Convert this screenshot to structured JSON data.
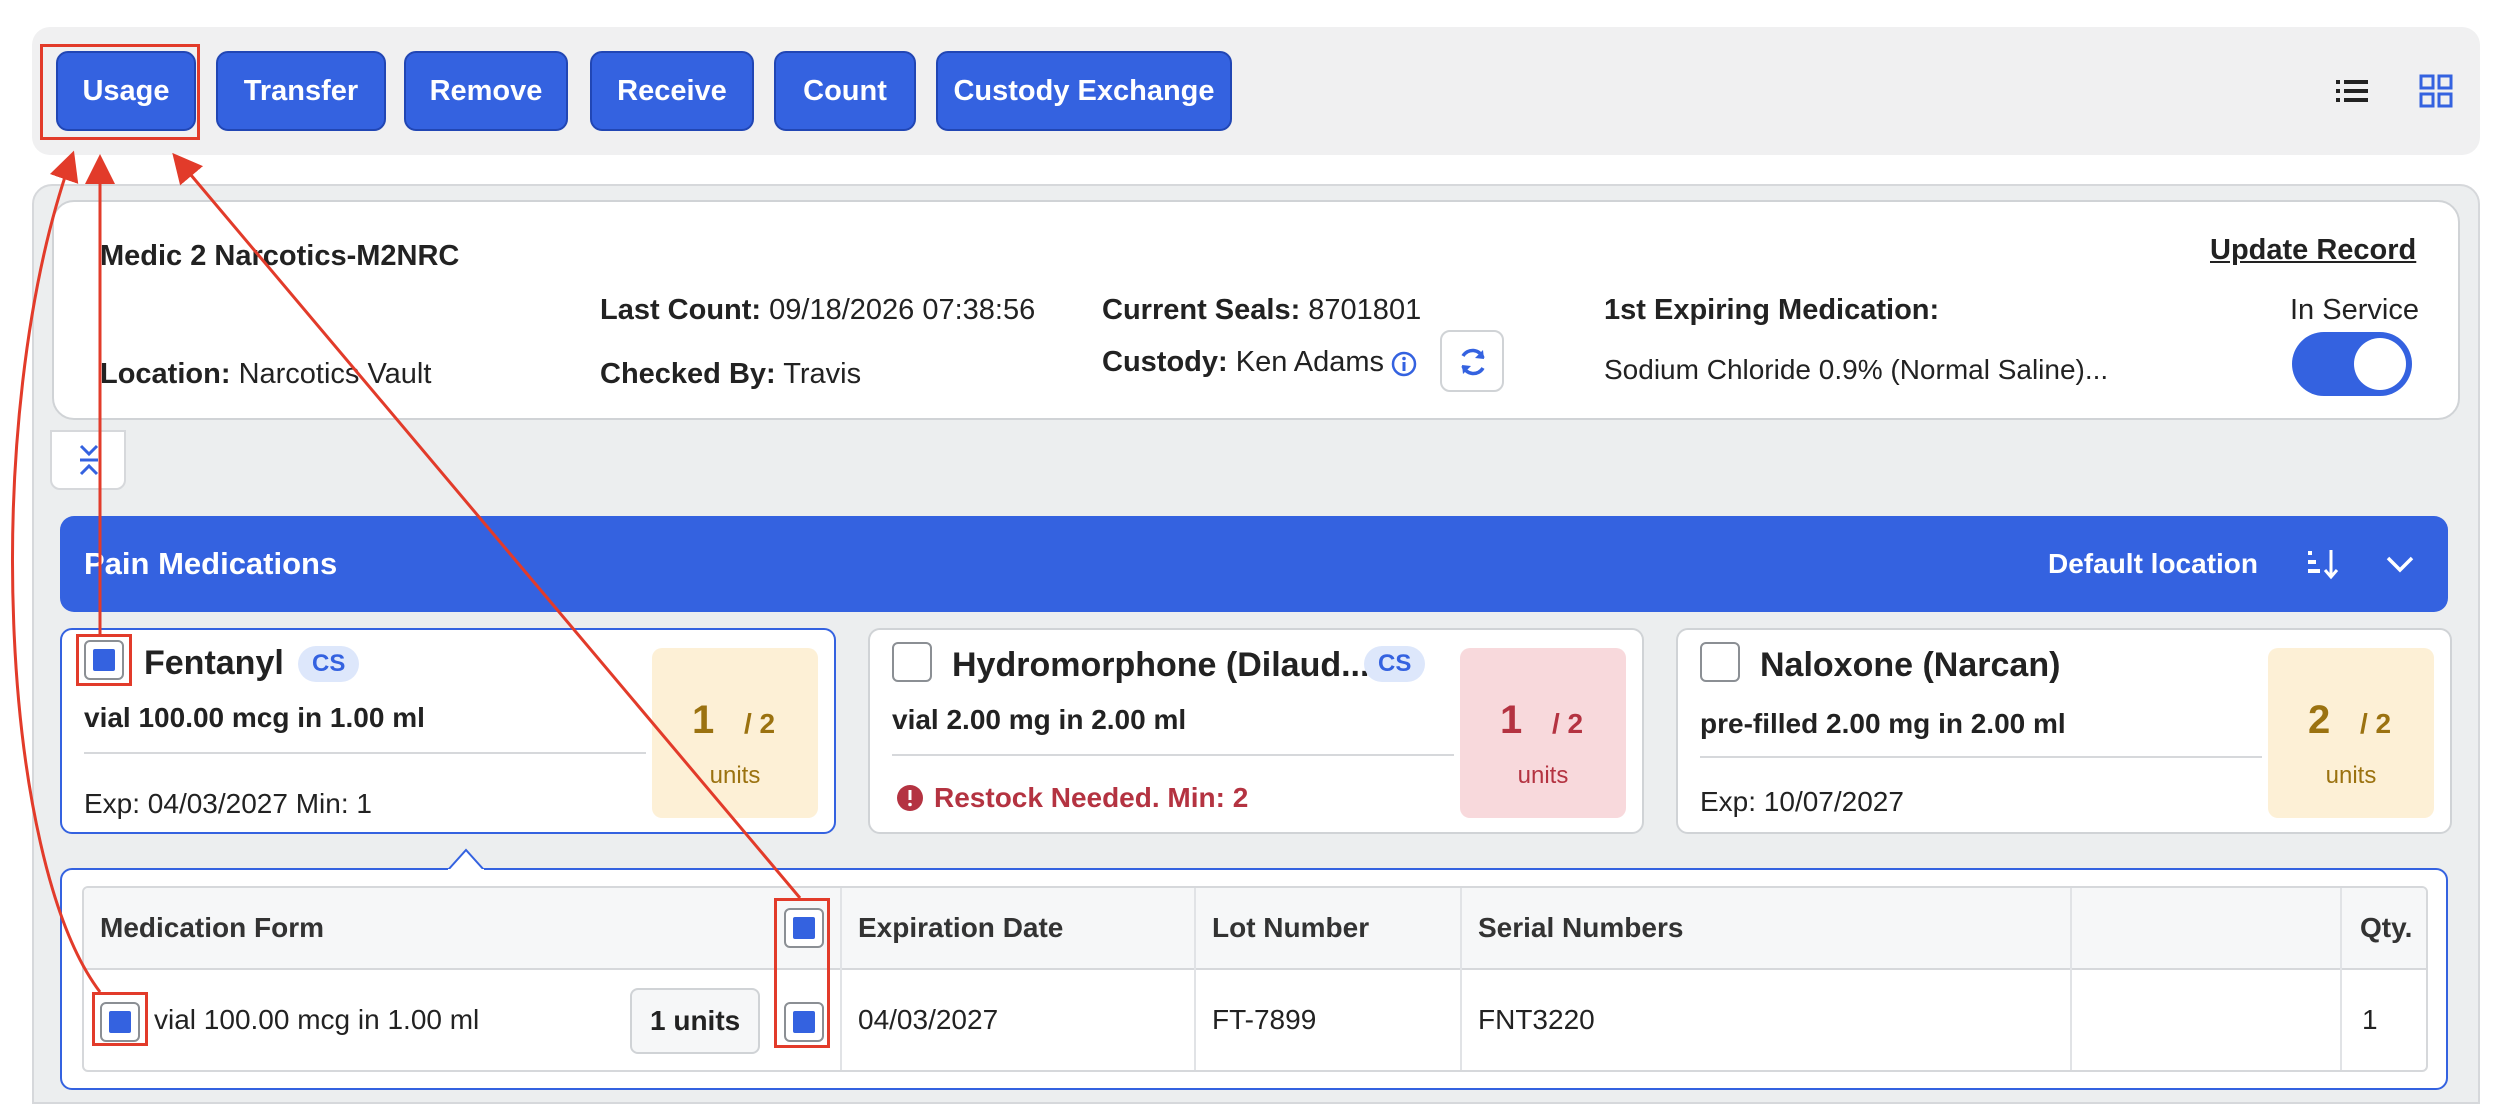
{
  "toolbar": {
    "buttons": [
      "Usage",
      "Transfer",
      "Remove",
      "Receive",
      "Count",
      "Custody Exchange"
    ],
    "list_view_icon": "list-icon",
    "grid_view_icon": "grid-icon"
  },
  "unit_info": {
    "name": "Medic 2 Narcotics-M2NRC",
    "location_label": "Location:",
    "location_value": "Narcotics Vault",
    "last_count_label": "Last Count:",
    "last_count_value": "09/18/2026 07:38:56",
    "checked_by_label": "Checked By:",
    "checked_by_value": "Travis",
    "seals_label": "Current Seals:",
    "seals_value": "8701801",
    "custody_label": "Custody:",
    "custody_value": "Ken Adams",
    "expiring_label": "1st Expiring Medication:",
    "expiring_value": "Sodium Chloride 0.9% (Normal Saline)...",
    "update_record": "Update Record",
    "service_label": "In Service",
    "in_service": true
  },
  "category": {
    "title": "Pain Medications",
    "sort_label": "Default location"
  },
  "medications": [
    {
      "name": "Fentanyl",
      "badge": "CS",
      "form": "vial 100.00 mcg in 1.00 ml",
      "footer": "Exp: 04/03/2027 Min: 1",
      "qty": "1",
      "total": "/ 2",
      "unit": "units",
      "checked": true,
      "status": "warn"
    },
    {
      "name": "Hydromorphone (Dilaud...",
      "badge": "CS",
      "form": "vial 2.00 mg in 2.00 ml",
      "footer": "Restock Needed.  Min: 2",
      "qty": "1",
      "total": "/ 2",
      "unit": "units",
      "checked": false,
      "status": "danger"
    },
    {
      "name": "Naloxone (Narcan)",
      "badge": "",
      "form": "pre-filled 2.00 mg in 2.00 ml",
      "footer": "Exp: 10/07/2027",
      "qty": "2",
      "total": "/ 2",
      "unit": "units",
      "checked": false,
      "status": "warn"
    }
  ],
  "detail_table": {
    "headers": [
      "Medication Form",
      "Expiration Date",
      "Lot Number",
      "Serial Numbers",
      "Qty."
    ],
    "row": {
      "form": "vial 100.00 mcg in 1.00 ml",
      "units": "1 units",
      "expiration": "04/03/2027",
      "lot": "FT-7899",
      "serial": "FNT3220",
      "qty": "1"
    }
  },
  "colors": {
    "primary": "#3462e0",
    "annotation": "#e23b2a",
    "warn_bg": "#fdf0d6",
    "danger_bg": "#f8d9dc"
  }
}
